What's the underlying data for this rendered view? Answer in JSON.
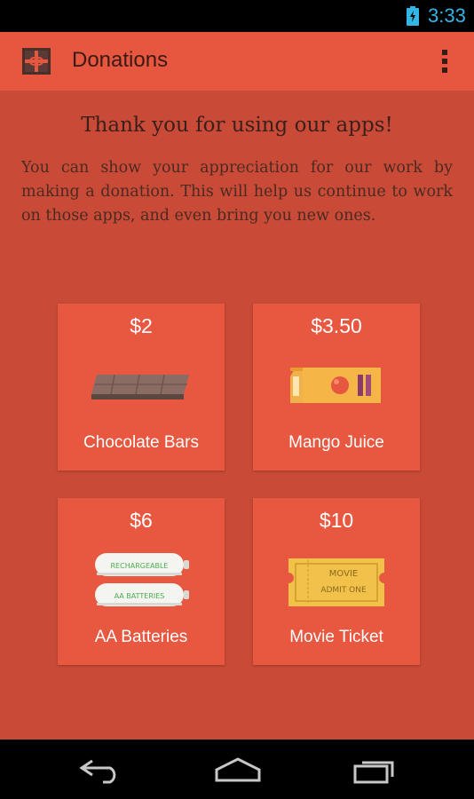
{
  "status_bar": {
    "time": "3:33",
    "battery_icon": "battery-charging-icon",
    "accent": "#33b5e5"
  },
  "action_bar": {
    "title": "Donations",
    "app_icon": "gift-icon",
    "menu_icon": "overflow-menu-icon",
    "color": "#e7563f"
  },
  "main": {
    "heading": "Thank you for using our apps!",
    "body": "You can show your appreciation for our work by making a donation. This will help us continue to work on those apps, and even bring you new ones.",
    "background": "#c94b37"
  },
  "donations": [
    {
      "price": "$2",
      "label": "Chocolate Bars",
      "icon": "chocolate-bar-icon"
    },
    {
      "price": "$3.50",
      "label": "Mango Juice",
      "icon": "juice-carton-icon"
    },
    {
      "price": "$6",
      "label": "AA Batteries",
      "icon": "batteries-icon",
      "illustration_text": [
        "RECHARGEABLE",
        "AA BATTERIES"
      ]
    },
    {
      "price": "$10",
      "label": "Movie Ticket",
      "icon": "movie-ticket-icon",
      "illustration_text": [
        "MOVIE",
        "ADMIT ONE"
      ]
    }
  ],
  "nav_bar": {
    "back_icon": "back-icon",
    "home_icon": "home-icon",
    "recents_icon": "recent-apps-icon"
  }
}
